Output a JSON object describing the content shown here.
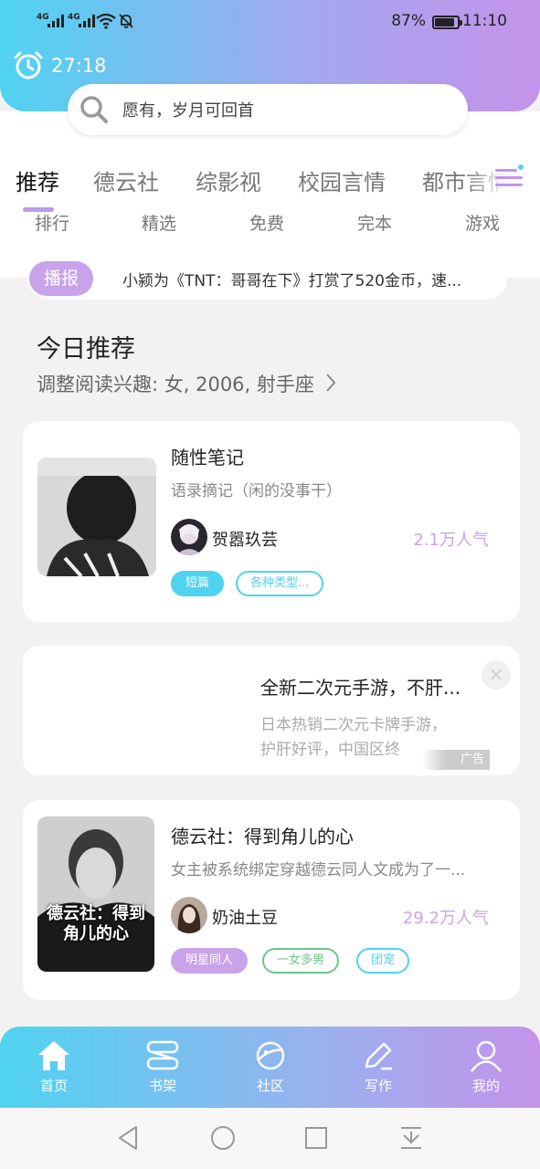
{
  "status_bar": {
    "signal1": "4G",
    "signal2": "4G",
    "battery_pct": "87%",
    "battery_level": 0.87,
    "time": "11:10"
  },
  "timer": {
    "value": "27:18",
    "icon": "alarm-clock-icon"
  },
  "search": {
    "placeholder": "愿有，岁月可回首",
    "icon": "search-icon"
  },
  "tabs": [
    "推荐",
    "德云社",
    "综影视",
    "校园言情",
    "都市言情"
  ],
  "active_tab": 0,
  "subtabs": [
    "排行",
    "精选",
    "免费",
    "完本",
    "游戏"
  ],
  "broadcast": {
    "badge": "播报",
    "message": "小颍为《TNT：哥哥在下》打赏了520金币，速..."
  },
  "section": {
    "title": "今日推荐",
    "subtitle": "调整阅读兴趣: 女, 2006, 射手座"
  },
  "books": [
    {
      "title": "随性笔记",
      "desc": "语录摘记（闲的没事干）",
      "author": "贺嚣玖芸",
      "popularity": "2.1万人气",
      "tags": [
        {
          "label": "短篇",
          "color": "#4fd3f0",
          "filled": true
        },
        {
          "label": "各种类型...",
          "color": "#4fd3f0",
          "filled": false
        }
      ]
    },
    {
      "title": "德云社：得到角儿的心",
      "desc": "女主被系统绑定穿越德云同人文成为了一...",
      "author": "奶油土豆",
      "popularity": "29.2万人气",
      "cover_text": "德云社：得到角儿的心",
      "tags": [
        {
          "label": "明星同人",
          "color": "#c9a3ea",
          "filled": true
        },
        {
          "label": "一女多男",
          "color": "#6cc58a",
          "filled": false
        },
        {
          "label": "团宠",
          "color": "#4fd3f0",
          "filled": false
        }
      ]
    }
  ],
  "ad": {
    "title": "全新二次元手游，不肝...",
    "text": "日本热销二次元卡牌手游，护肝好评，中国区终",
    "close": "×",
    "mark": "广告"
  },
  "bottom_nav": [
    {
      "label": "首页",
      "icon": "home-icon"
    },
    {
      "label": "书架",
      "icon": "bookshelf-icon"
    },
    {
      "label": "社区",
      "icon": "planet-icon"
    },
    {
      "label": "写作",
      "icon": "pen-icon"
    },
    {
      "label": "我的",
      "icon": "profile-icon"
    }
  ],
  "colors": {
    "accent_cyan": "#4fd3f0",
    "accent_purple": "#c493ea",
    "popularity": "#c9a3ea"
  }
}
